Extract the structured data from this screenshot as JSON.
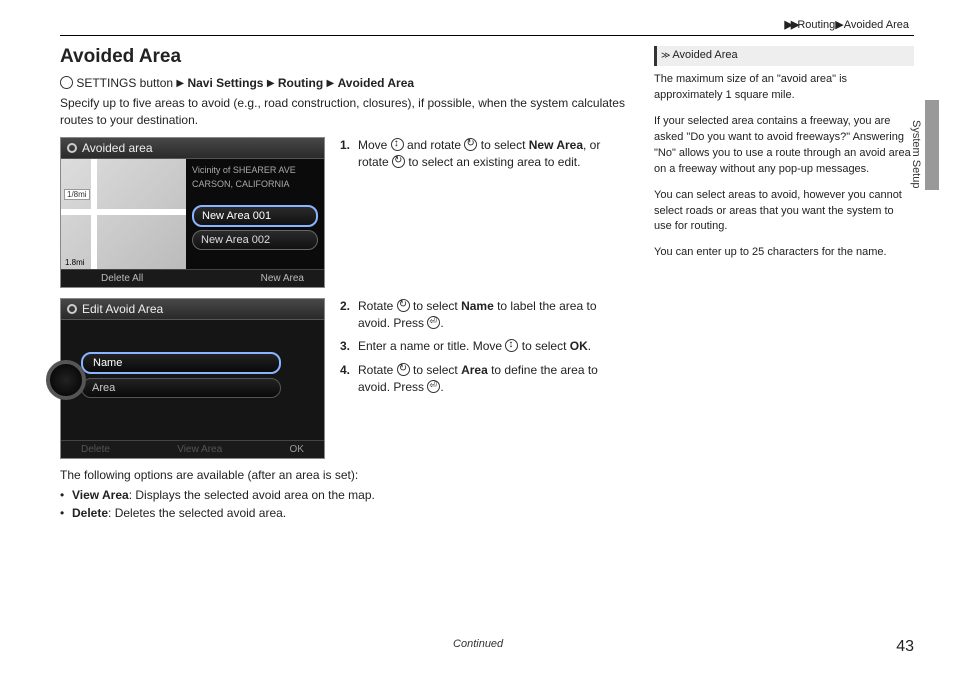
{
  "breadcrumb": {
    "arrows": "▶▶",
    "part1": "Routing",
    "sep": "▶",
    "part2": "Avoided Area"
  },
  "title": "Avoided Area",
  "navpath": {
    "icon_label": "SETTINGS button",
    "items": [
      "Navi Settings",
      "Routing",
      "Avoided Area"
    ]
  },
  "intro": "Specify up to five areas to avoid (e.g., road construction, closures), if possible, when the system calculates routes to your destination.",
  "screenshot1": {
    "header": "Avoided area",
    "vicinity_line1": "Vicinity of SHEARER AVE",
    "vicinity_line2": "CARSON, CALIFORNIA",
    "scale_top": "1/8mi",
    "scale_bottom": "1.8mi",
    "item1": "New Area 001",
    "item2": "New Area 002",
    "footer_left": "Delete All",
    "footer_right": "New Area"
  },
  "screenshot2": {
    "header": "Edit Avoid Area",
    "field1": "Name",
    "field2": "Area",
    "footer_left": "Delete",
    "footer_mid": "View Area",
    "footer_right": "OK"
  },
  "steps_a": {
    "s1_a": "Move ",
    "s1_b": " and rotate ",
    "s1_c": " to select ",
    "s1_bold": "New Area",
    "s1_d": ", or rotate ",
    "s1_e": " to select an existing area to edit."
  },
  "steps_b": {
    "s2_a": "Rotate ",
    "s2_b": " to select ",
    "s2_bold": "Name",
    "s2_c": " to label the area to avoid. Press ",
    "s2_d": ".",
    "s3_a": "Enter a name or title. Move ",
    "s3_b": " to select ",
    "s3_bold": "OK",
    "s3_c": ".",
    "s4_a": "Rotate ",
    "s4_b": " to select ",
    "s4_bold": "Area",
    "s4_c": " to define the area to avoid. Press ",
    "s4_d": "."
  },
  "after": "The following options are available (after an area is set):",
  "bullets": {
    "b1_bold": "View Area",
    "b1_rest": ": Displays the selected avoid area on the map.",
    "b2_bold": "Delete",
    "b2_rest": ": Deletes the selected avoid area."
  },
  "side": {
    "header": "Avoided Area",
    "p1": "The maximum size of an \"avoid area\" is approximately 1 square mile.",
    "p2": "If your selected area contains a freeway, you are asked \"Do you want to avoid freeways?\" Answering \"No\" allows you to use a route through an avoid area on a freeway without any pop-up messages.",
    "p3": "You can select areas to avoid, however you cannot select roads or areas that you want the system to use for routing.",
    "p4": "You can enter up to 25 characters for the name."
  },
  "tab": "System Setup",
  "continued": "Continued",
  "page": "43"
}
